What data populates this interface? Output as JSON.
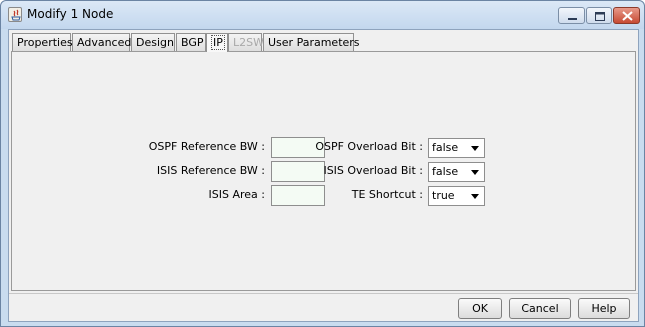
{
  "window": {
    "title": "Modify 1 Node"
  },
  "tabs": [
    {
      "label": "Properties",
      "state": "normal"
    },
    {
      "label": "Advanced",
      "state": "normal"
    },
    {
      "label": "Design",
      "state": "normal"
    },
    {
      "label": "BGP",
      "state": "normal"
    },
    {
      "label": "IP",
      "state": "selected"
    },
    {
      "label": "L2SW",
      "state": "disabled"
    },
    {
      "label": "User Parameters",
      "state": "normal"
    }
  ],
  "form": {
    "ospf_ref_bw_label": "OSPF Reference BW :",
    "ospf_ref_bw_value": "",
    "isis_ref_bw_label": "ISIS Reference BW :",
    "isis_ref_bw_value": "",
    "isis_area_label": "ISIS Area :",
    "isis_area_value": "",
    "ospf_overload_label": "OSPF Overload Bit :",
    "ospf_overload_value": "false",
    "isis_overload_label": "ISIS Overload Bit :",
    "isis_overload_value": "false",
    "te_shortcut_label": "TE Shortcut :",
    "te_shortcut_value": "true"
  },
  "buttons": {
    "ok": "OK",
    "cancel": "Cancel",
    "help": "Help"
  },
  "colors": {
    "titlebar": "#c9dcef",
    "panel": "#f0f0f0",
    "text_field": "#f4fbf4",
    "close_button": "#c74a33"
  },
  "icons": {
    "app": "java-app-icon",
    "minimize": "minimize-icon",
    "maximize": "maximize-icon",
    "close": "close-icon",
    "dropdown": "chevron-down-icon"
  }
}
